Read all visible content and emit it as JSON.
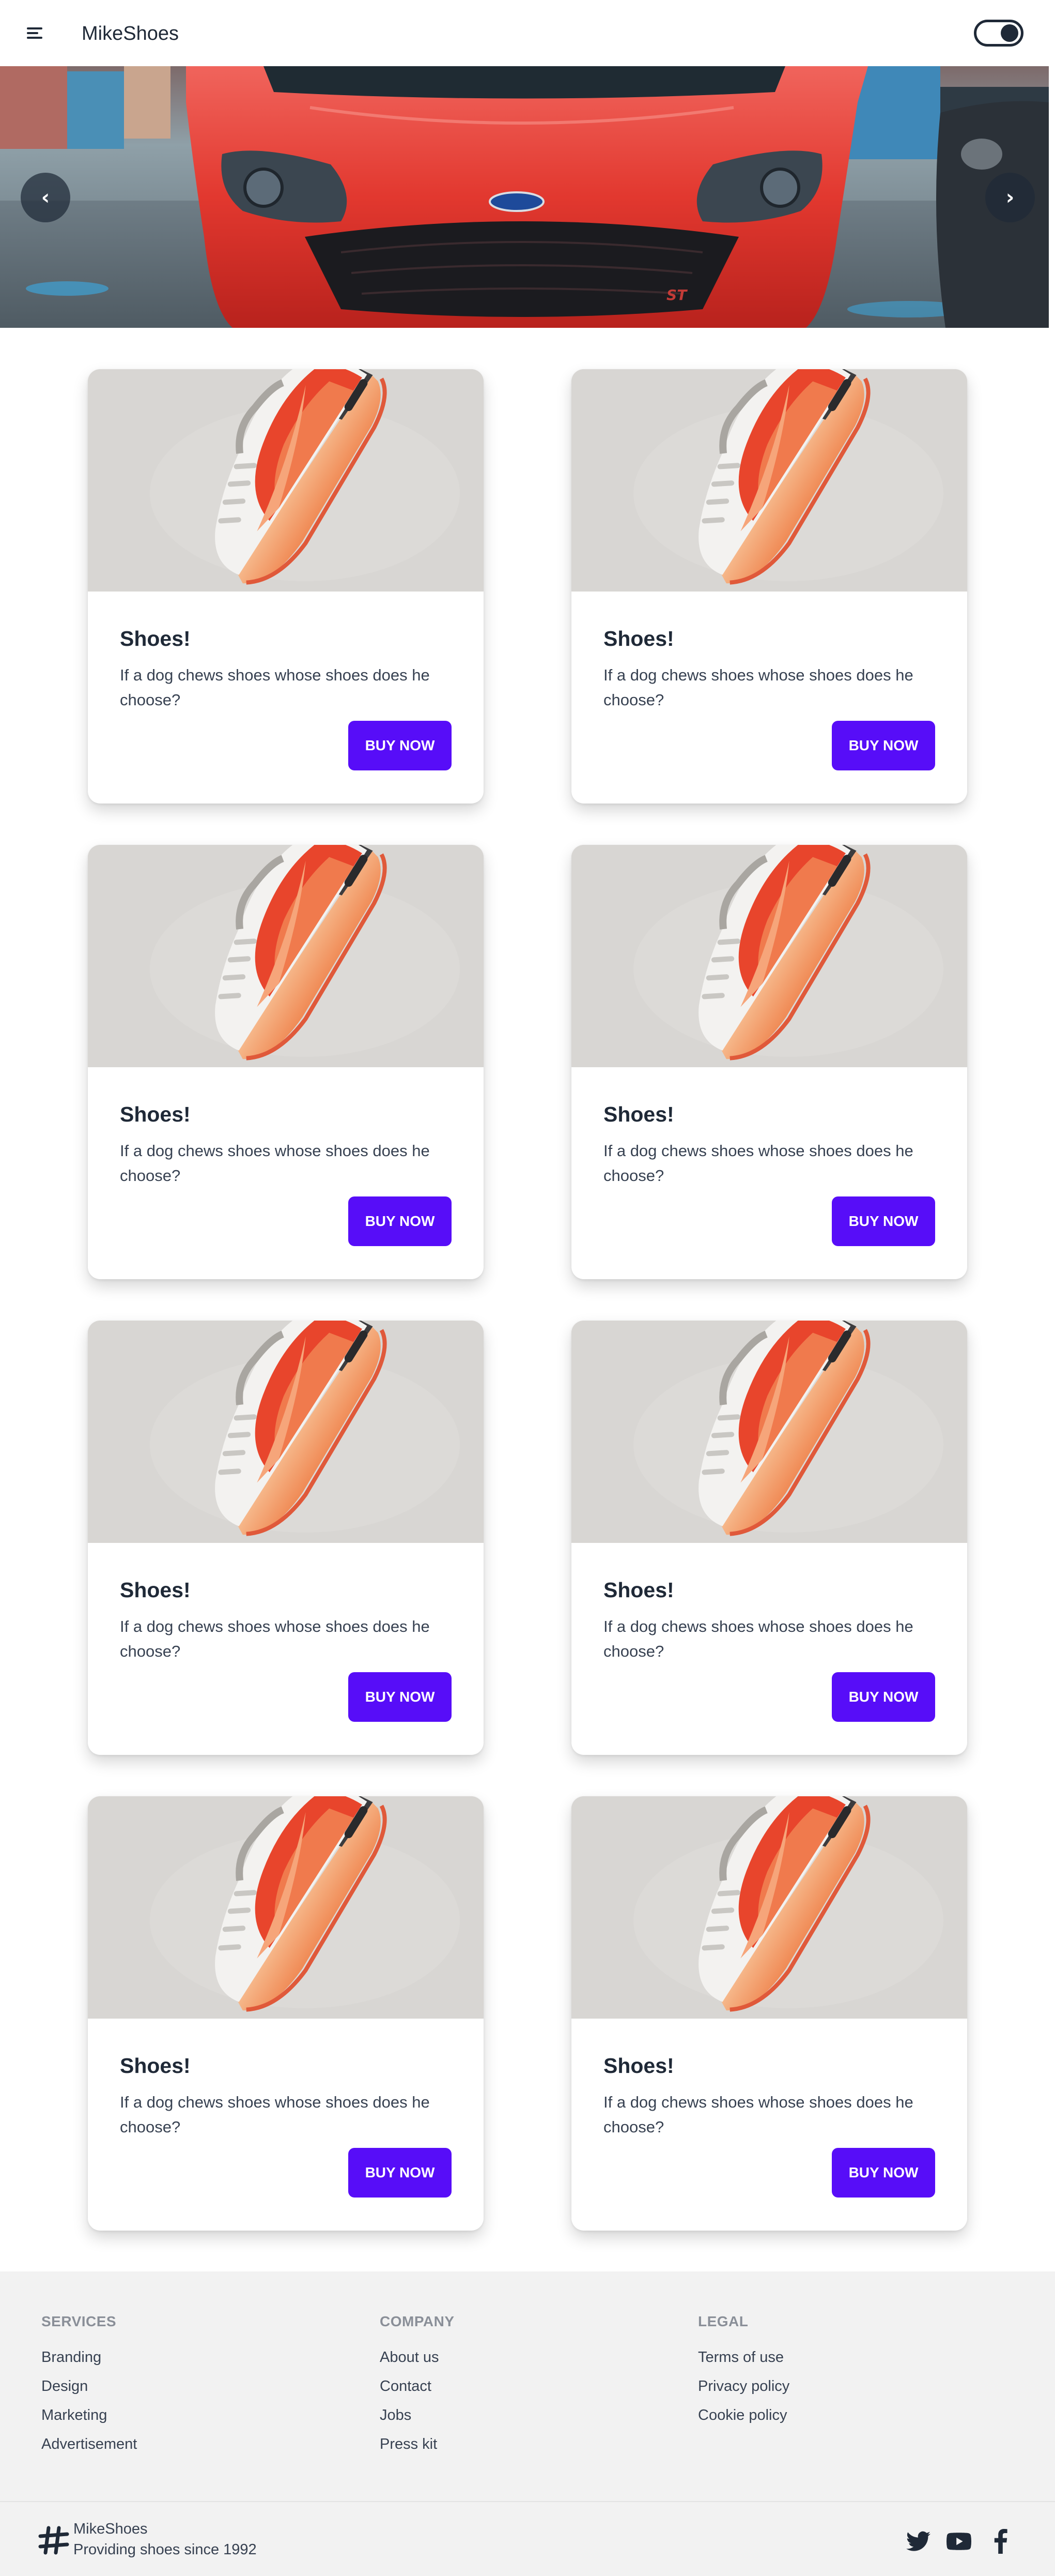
{
  "navbar": {
    "menu_icon": "hamburger-menu-icon",
    "brand": "MikeShoes",
    "toggle_icon": "theme-toggle"
  },
  "carousel": {
    "prev_label": "‹",
    "next_label": "›",
    "slide_badge": "ST"
  },
  "products": [
    {
      "title": "Shoes!",
      "description": "If a dog chews shoes whose shoes does he choose?",
      "button": "BUY NOW"
    },
    {
      "title": "Shoes!",
      "description": "If a dog chews shoes whose shoes does he choose?",
      "button": "BUY NOW"
    },
    {
      "title": "Shoes!",
      "description": "If a dog chews shoes whose shoes does he choose?",
      "button": "BUY NOW"
    },
    {
      "title": "Shoes!",
      "description": "If a dog chews shoes whose shoes does he choose?",
      "button": "BUY NOW"
    },
    {
      "title": "Shoes!",
      "description": "If a dog chews shoes whose shoes does he choose?",
      "button": "BUY NOW"
    },
    {
      "title": "Shoes!",
      "description": "If a dog chews shoes whose shoes does he choose?",
      "button": "BUY NOW"
    },
    {
      "title": "Shoes!",
      "description": "If a dog chews shoes whose shoes does he choose?",
      "button": "BUY NOW"
    },
    {
      "title": "Shoes!",
      "description": "If a dog chews shoes whose shoes does he choose?",
      "button": "BUY NOW"
    }
  ],
  "footer": {
    "services": {
      "heading": "SERVICES",
      "links": [
        "Branding",
        "Design",
        "Marketing",
        "Advertisement"
      ]
    },
    "company": {
      "heading": "COMPANY",
      "links": [
        "About us",
        "Contact",
        "Jobs",
        "Press kit"
      ]
    },
    "legal": {
      "heading": "LEGAL",
      "links": [
        "Terms of use",
        "Privacy policy",
        "Cookie policy"
      ]
    },
    "brand": "MikeShoes",
    "tagline": "Providing shoes since 1992",
    "social_icons": [
      "twitter-icon",
      "youtube-icon",
      "facebook-icon"
    ]
  },
  "colors": {
    "primary": "#570df8",
    "text": "#1f2937",
    "footer_bg": "#f2f2f2",
    "car_red": "#e5332a"
  }
}
